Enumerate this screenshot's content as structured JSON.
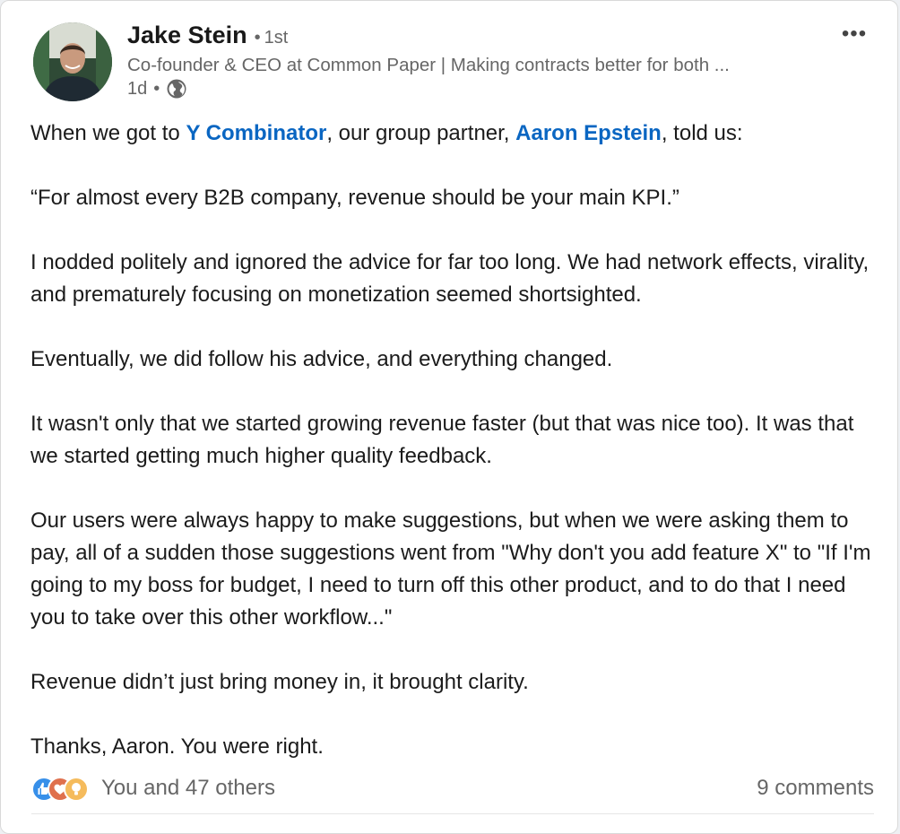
{
  "author": {
    "name": "Jake Stein",
    "degree": "1st",
    "headline": "Co-founder & CEO at Common Paper | Making contracts better for both ...",
    "time": "1d",
    "visibility_icon": "globe-icon"
  },
  "post": {
    "p1_before": "When we got to ",
    "p1_mention1": "Y Combinator",
    "p1_middle": ", our group partner, ",
    "p1_mention2": "Aaron Epstein",
    "p1_after": ", told us:",
    "p2": "“For almost every B2B company, revenue should be your main KPI.”",
    "p3": "I nodded politely and ignored the advice for far too long. We had network effects, virality, and prematurely focusing on monetization seemed shortsighted.",
    "p4": "Eventually, we did follow his advice, and everything changed.",
    "p5": "It wasn't only that we started growing revenue faster (but that was nice too). It was that we started getting much higher quality feedback.",
    "p6": "Our users were always happy to make suggestions, but when we were asking them to pay, all of a sudden those suggestions went from \"Why don't you add feature X\" to \"If I'm going to my boss for budget, I need to turn off this other product, and to do that I need you to take over this other workflow...\"",
    "p7": "Revenue didn’t just bring money in, it brought clarity.",
    "p8": "Thanks, Aaron. You were right."
  },
  "social": {
    "reactions_text": "You and 47 others",
    "comments_text": "9 comments",
    "reaction_icons": [
      "like-icon",
      "love-icon",
      "insightful-icon"
    ]
  },
  "colors": {
    "link": "#0a66c2",
    "muted": "#666666",
    "text": "#1b1b1b"
  }
}
